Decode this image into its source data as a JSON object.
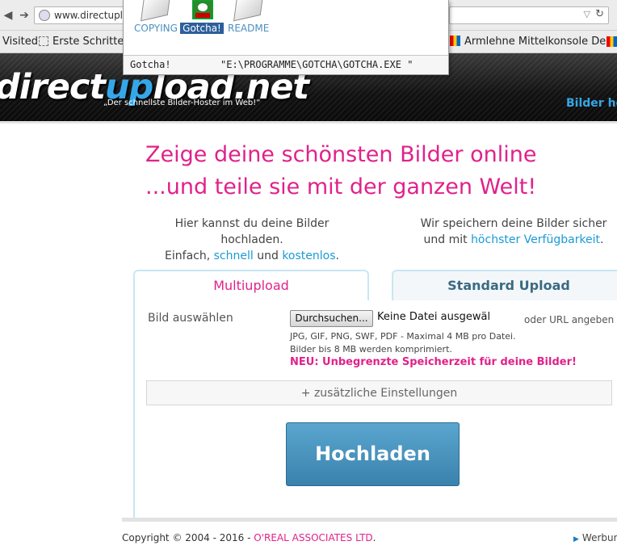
{
  "browser": {
    "url": "www.directuplo",
    "bookmarks": [
      {
        "label": "Visited"
      },
      {
        "label": "Erste Schritte"
      },
      {
        "label": "Armlehne Mittelkonsole De..."
      }
    ]
  },
  "file_dialog": {
    "files": [
      {
        "label": "COPYING",
        "icon": "document-icon"
      },
      {
        "label": "Gotcha!",
        "icon": "gotcha-app-icon",
        "selected": true
      },
      {
        "label": "README",
        "icon": "document-icon"
      }
    ],
    "status_name": "Gotcha!",
    "status_path": "\"E:\\PROGRAMME\\GOTCHA\\GOTCHA.EXE \""
  },
  "header": {
    "logo_main": "direct",
    "logo_hl": "up",
    "logo_end": "load.net",
    "tagline": "„Der schnellste Bilder-Hoster im Web!“",
    "nav_link": "Bilder ho"
  },
  "hero": {
    "line1": "Zeige deine schönsten Bilder online",
    "line2": "...und teile sie mit der ganzen Welt!"
  },
  "info_left": {
    "line1": "Hier kannst du deine Bilder hochladen.",
    "prefix": "Einfach, ",
    "link1": "schnell",
    "mid": " und ",
    "link2": "kostenlos",
    "suffix": "."
  },
  "info_right": {
    "line1": "Wir speichern deine Bilder sicher",
    "prefix": "und mit ",
    "link": "höchster Verfügbarkeit",
    "suffix": "."
  },
  "upload": {
    "tab_multi": "Multiupload",
    "tab_standard": "Standard Upload",
    "bild_label": "Bild auswählen",
    "browse_label": "Durchsuchen...",
    "no_file": "Keine Datei ausgewäl",
    "url_toggle": "oder URL angeben",
    "hint1": "JPG, GIF, PNG, SWF, PDF - Maximal 4 MB pro Datei.",
    "hint2": "Bilder bis 8 MB werden komprimiert.",
    "neu": "NEU: Unbegrenzte Speicherzeit für deine Bilder!",
    "extra_settings": "+ zusätzliche Einstellungen",
    "submit": "Hochladen"
  },
  "footer": {
    "copyright": "Copyright © 2004 - 2016 - ",
    "company": "O'REAL ASSOCIATES LTD",
    "period": ".",
    "werbung": "Werbun"
  },
  "colors": {
    "accent_pink": "#e0228a",
    "link_blue": "#1a9ad6",
    "button_blue": "#3a82ad",
    "header_dark": "#111111"
  }
}
